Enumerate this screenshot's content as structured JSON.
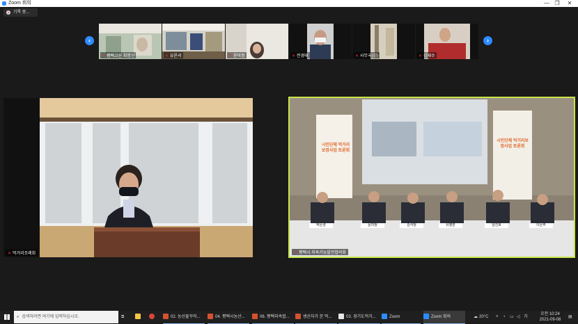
{
  "window": {
    "title": "Zoom 회의",
    "minimize": "—",
    "maximize": "❐",
    "close": "✕"
  },
  "recording": {
    "label": "기록 중..."
  },
  "gallery": {
    "participants": [
      {
        "name": "평택고산 최명신"
      },
      {
        "name": "유윤서"
      },
      {
        "name": "윤미정"
      },
      {
        "name": "전경태"
      },
      {
        "name": "사무국(김)"
      },
      {
        "name": "김재수"
      }
    ],
    "prev_arrow": "‹",
    "next_arrow": "›"
  },
  "main": {
    "left_tile": {
      "name": "먹거리조례회"
    },
    "right_tile": {
      "name": "평택시 지속가능발전협의회",
      "banner_text": "시민단체 먹거리보장사업 토론회",
      "name_plates": [
        "박은경",
        "윤미정",
        "김석정",
        "유병훈",
        "임진호",
        "이은주"
      ]
    }
  },
  "taskbar": {
    "search_placeholder": "검색하려면 여기에 입력하십시오.",
    "apps": [
      {
        "label": "02. 농산물꾸러..."
      },
      {
        "label": "04. 평택시농산..."
      },
      {
        "label": "06. 평택지속협..."
      },
      {
        "label": "생산자가 본 먹..."
      },
      {
        "label": "03. 경기도먹거..."
      },
      {
        "label": "Zoom"
      },
      {
        "label": "Zoom 회의"
      }
    ],
    "temperature": "20°C",
    "ime": "가",
    "time": "오전 10:24",
    "date": "2021-09-08"
  },
  "colors": {
    "accent": "#2d8cff",
    "active_speaker": "#c8e64a",
    "mic_muted": "#e33333"
  }
}
